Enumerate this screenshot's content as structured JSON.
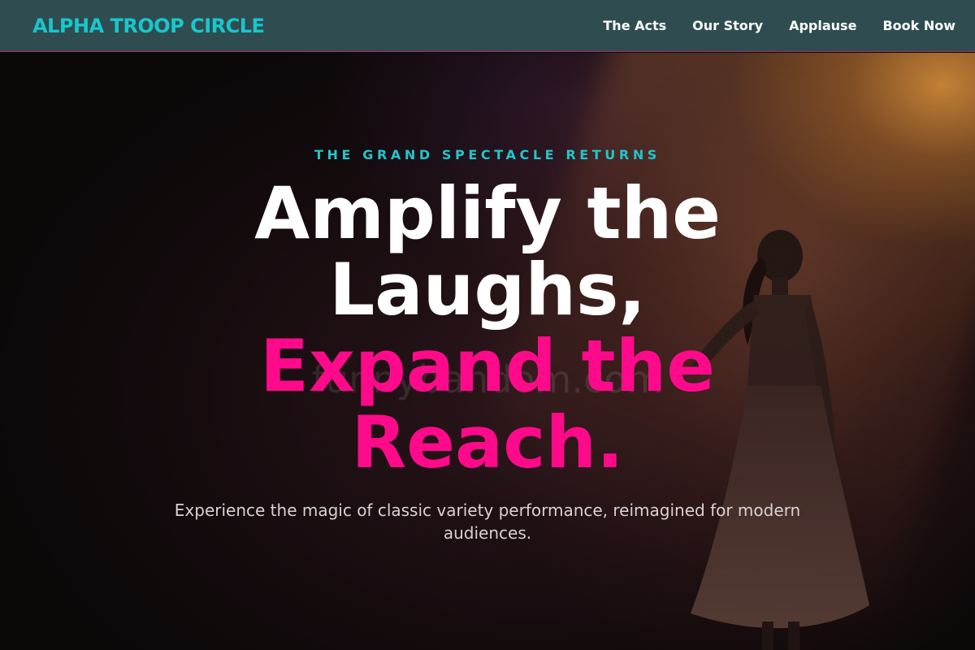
{
  "brand": {
    "name": "ALPHA TROOP CIRCLE"
  },
  "nav": {
    "items": [
      {
        "label": "The Acts"
      },
      {
        "label": "Our Story"
      },
      {
        "label": "Applause"
      },
      {
        "label": "Book Now"
      }
    ]
  },
  "hero": {
    "eyebrow": "THE GRAND SPECTACLE RETURNS",
    "headline_line1": "Amplify the",
    "headline_line2": "Laughs,",
    "headline_line3": "Expand the",
    "headline_line4": "Reach.",
    "subtext": "Experience the magic of classic variety performance, reimagined for modern audiences.",
    "watermark": "funnybandom.com"
  },
  "colors": {
    "navbar_bg": "#2f4d50",
    "brand_teal": "#19c6cc",
    "accent_pink": "#ff0a8a",
    "headline_white": "#ffffff"
  }
}
